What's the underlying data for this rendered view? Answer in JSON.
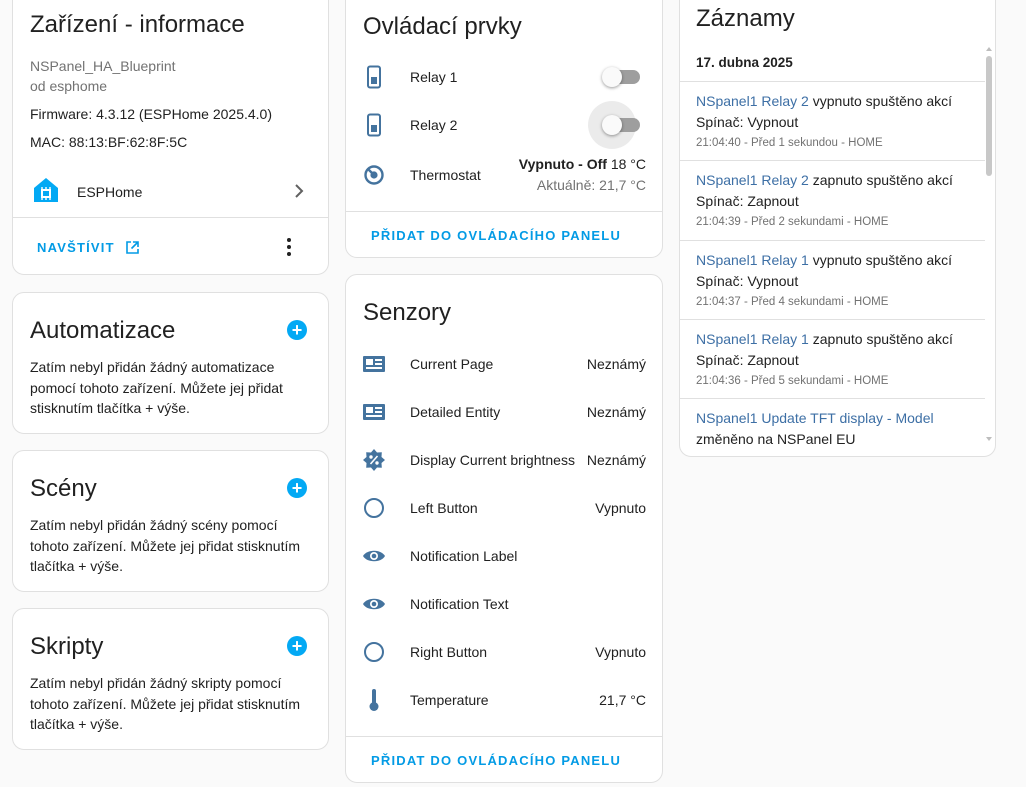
{
  "device_info": {
    "title": "Zařízení - informace",
    "model": "NSPanel_HA_Blueprint",
    "manufacturer": "od esphome",
    "firmware": "Firmware: 4.3.12 (ESPHome 2025.4.0)",
    "mac": "MAC: 88:13:BF:62:8F:5C",
    "integration_label": "ESPHome",
    "visit_label": "NAVŠTÍVIT"
  },
  "automations": {
    "title": "Automatizace",
    "text": "Zatím nebyl přidán žádný automatizace pomocí tohoto zařízení. Můžete jej přidat stisknutím tlačítka + výše."
  },
  "scenes": {
    "title": "Scény",
    "text": "Zatím nebyl přidán žádný scény pomocí tohoto zařízení. Můžete jej přidat stisknutím tlačítka + výše."
  },
  "scripts": {
    "title": "Skripty",
    "text": "Zatím nebyl přidán žádný skripty pomocí tohoto zařízení. Můžete jej přidat stisknutím tlačítka + výše."
  },
  "controls": {
    "title": "Ovládací prvky",
    "relay1": {
      "label": "Relay 1",
      "state": "off",
      "icon": "relay-icon"
    },
    "relay2": {
      "label": "Relay 2",
      "state": "off",
      "icon": "relay-icon"
    },
    "thermostat": {
      "label": "Thermostat",
      "state_bold": "Vypnuto - Off",
      "setpoint": "18 °C",
      "current": "Aktuálně: 21,7 °C",
      "icon": "thermostat-icon"
    },
    "add_label": "PŘIDAT DO OVLÁDACÍHO PANELU"
  },
  "sensors": {
    "title": "Senzory",
    "items": [
      {
        "label": "Current Page",
        "value": "Neznámý",
        "icon": "card-text-icon"
      },
      {
        "label": "Detailed Entity",
        "value": "Neznámý",
        "icon": "card-text-icon"
      },
      {
        "label": "Display Current brightness",
        "value": "Neznámý",
        "icon": "brightness-percent-icon"
      },
      {
        "label": "Left Button",
        "value": "Vypnuto",
        "icon": "radio-off-icon"
      },
      {
        "label": "Notification Label",
        "value": "",
        "icon": "eye-icon"
      },
      {
        "label": "Notification Text",
        "value": "",
        "icon": "eye-icon"
      },
      {
        "label": "Right Button",
        "value": "Vypnuto",
        "icon": "radio-off-icon"
      },
      {
        "label": "Temperature",
        "value": "21,7 °C",
        "icon": "thermometer-icon"
      }
    ],
    "add_label": "PŘIDAT DO OVLÁDACÍHO PANELU"
  },
  "logbook": {
    "title": "Záznamy",
    "date": "17. dubna 2025",
    "entries": [
      {
        "entity": "NSpanel1 Relay 2",
        "action": " vypnuto spuštěno akcí",
        "detail": "Spínač: Vypnout",
        "meta": "21:04:40 - Před 1 sekundou - HOME"
      },
      {
        "entity": "NSpanel1 Relay 2",
        "action": " zapnuto spuštěno akcí",
        "detail": "Spínač: Zapnout",
        "meta": "21:04:39 - Před 2 sekundami - HOME"
      },
      {
        "entity": "NSpanel1 Relay 1",
        "action": " vypnuto spuštěno akcí",
        "detail": "Spínač: Vypnout",
        "meta": "21:04:37 - Před 4 sekundami - HOME"
      },
      {
        "entity": "NSpanel1 Relay 1",
        "action": " zapnuto spuštěno akcí",
        "detail": "Spínač: Zapnout",
        "meta": "21:04:36 - Před 5 sekundami - HOME"
      },
      {
        "entity": "NSpanel1 Update TFT display - Model",
        "action": "",
        "detail": "změněno na NSPanel EU",
        "meta": ""
      }
    ]
  },
  "colors": {
    "accent": "#03a9f4",
    "link": "#039be5",
    "icon": "#44739e",
    "entity_link": "#3d6fa5"
  }
}
